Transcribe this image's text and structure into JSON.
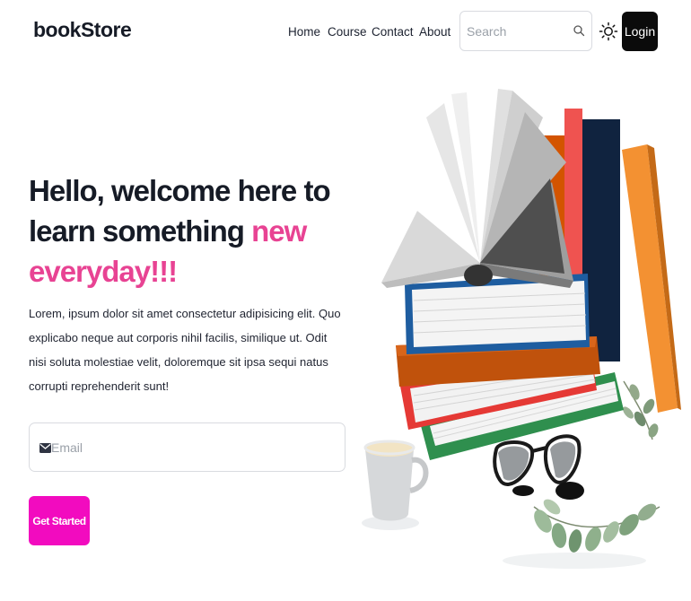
{
  "nav": {
    "logo": "bookStore",
    "links": [
      "Home",
      "Course",
      "Contact",
      "About"
    ],
    "search_placeholder": "Search",
    "login_label": "Login",
    "icons": {
      "search": "search-icon",
      "theme": "sun-icon"
    }
  },
  "hero": {
    "heading_main": "Hello, welcome here to learn something",
    "heading_accent": "new everyday!!!",
    "description": "Lorem, ipsum dolor sit amet consectetur adipisicing elit. Quo explicabo neque aut corporis nihil facilis, similique ut. Odit nisi soluta molestiae velit, doloremque sit ipsa sequi natus corrupti reprehenderit sunt!",
    "email_placeholder": "Email",
    "email_icon": "envelope-icon",
    "cta_label": "Get Started",
    "illustration": "books-stack-illustration"
  },
  "colors": {
    "accent": "#e84393",
    "cta": "#f20bbf",
    "login_bg": "#0b0b0b"
  }
}
